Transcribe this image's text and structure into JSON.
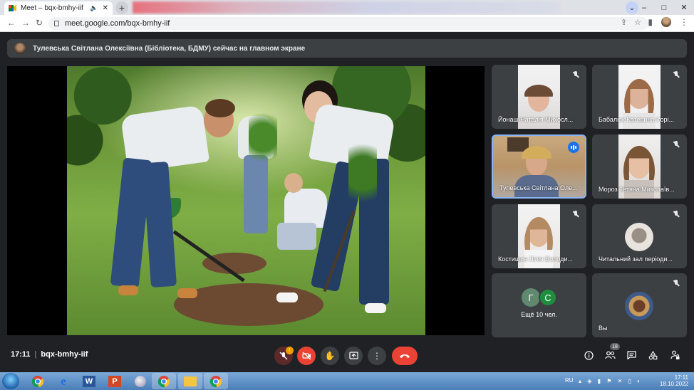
{
  "browser": {
    "tab_title": "Meet – bqx-bmhy-iif",
    "url": "meet.google.com/bqx-bmhy-iif",
    "new_tab_label": "+",
    "window_controls": [
      "–",
      "□",
      "✕"
    ]
  },
  "meet": {
    "presenter_banner": "Тулевська Світлана Олексіївна (Бібліотека, БДМУ) сейчас на главном экране",
    "participants": [
      {
        "name": "Йонаш Наталія Михосл...",
        "muted": true
      },
      {
        "name": "Бабалюк Катерина Ігорі...",
        "muted": true
      },
      {
        "name": "Тулевська Світлана Оле...",
        "muted": false,
        "speaking": true
      },
      {
        "name": "Мороз Тетяна Миколаїв...",
        "muted": true
      },
      {
        "name": "Костишин Лілія Володи...",
        "muted": true
      },
      {
        "name": "Читальний зал періоди...",
        "muted": true
      }
    ],
    "others": {
      "letters": [
        "Г",
        "С"
      ],
      "label": "Ещё 10 чел.",
      "colors": [
        "#5f8a6f",
        "#1e8e3e"
      ]
    },
    "self_tile": {
      "name": "Вы",
      "muted": true
    },
    "bottom": {
      "time": "17:11",
      "meeting_code": "bqx-bmhy-iif",
      "mic_badge": "!",
      "people_count": "18"
    },
    "colors": {
      "accent": "#1a73e8",
      "danger": "#ea4335",
      "warning": "#f29900"
    }
  },
  "taskbar": {
    "language": "RU",
    "time": "17:11",
    "date": "18.10.2022"
  }
}
